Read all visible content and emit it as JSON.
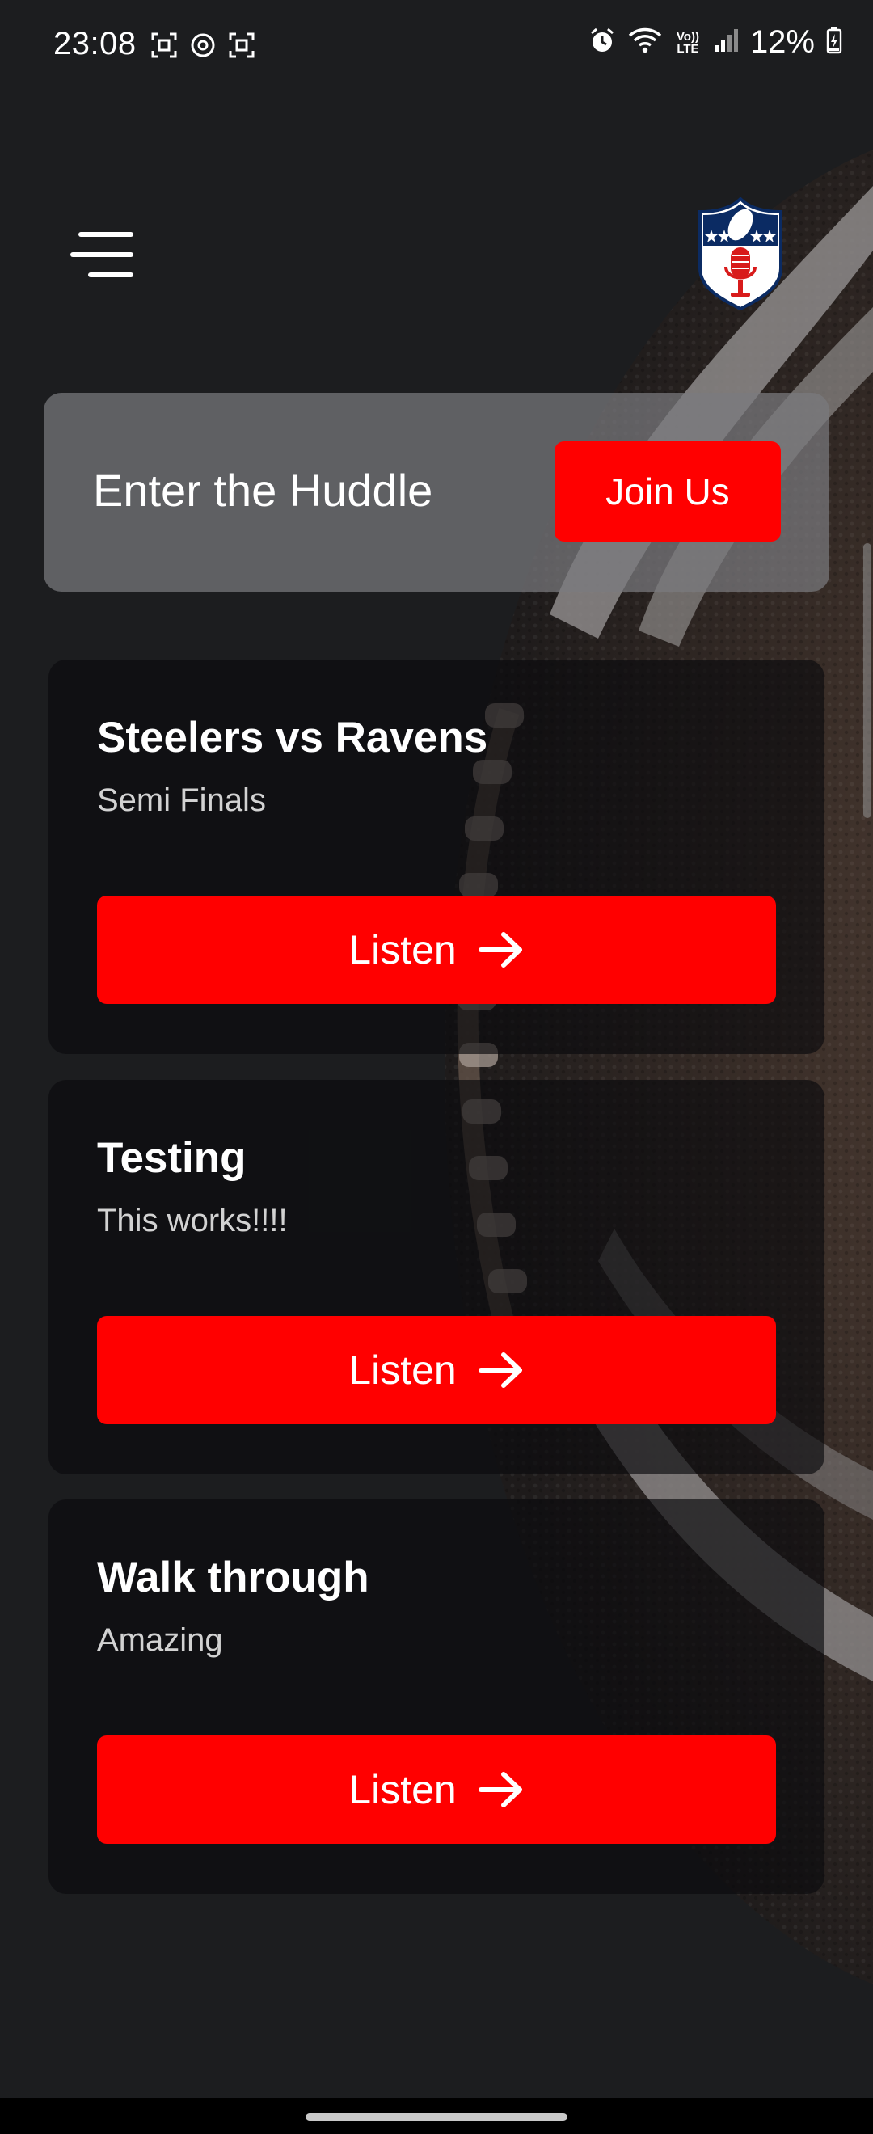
{
  "status_bar": {
    "time": "23:08",
    "battery": "12%",
    "left_icons": [
      "screenshot-icon",
      "sync-icon",
      "screenshot-icon"
    ],
    "right_icons": [
      "alarm-icon",
      "wifi-icon",
      "volte-icon",
      "signal-icon",
      "battery-icon"
    ],
    "volte_label": "Vo)) LTE"
  },
  "header": {
    "menu_icon": "hamburger-menu-icon",
    "logo_icon": "nfl-shield-microphone-logo"
  },
  "huddle": {
    "title": "Enter the Huddle",
    "button_label": "Join Us"
  },
  "cards": [
    {
      "title": "Steelers vs Ravens",
      "subtitle": "Semi Finals",
      "button_label": "Listen"
    },
    {
      "title": "Testing",
      "subtitle": "This works!!!!",
      "button_label": "Listen"
    },
    {
      "title": "Walk through",
      "subtitle": "Amazing",
      "button_label": "Listen"
    }
  ],
  "colors": {
    "background": "#1c1d1f",
    "accent": "#ff0000",
    "banner": "#7a7a7e",
    "card": "#0a0b0d"
  }
}
